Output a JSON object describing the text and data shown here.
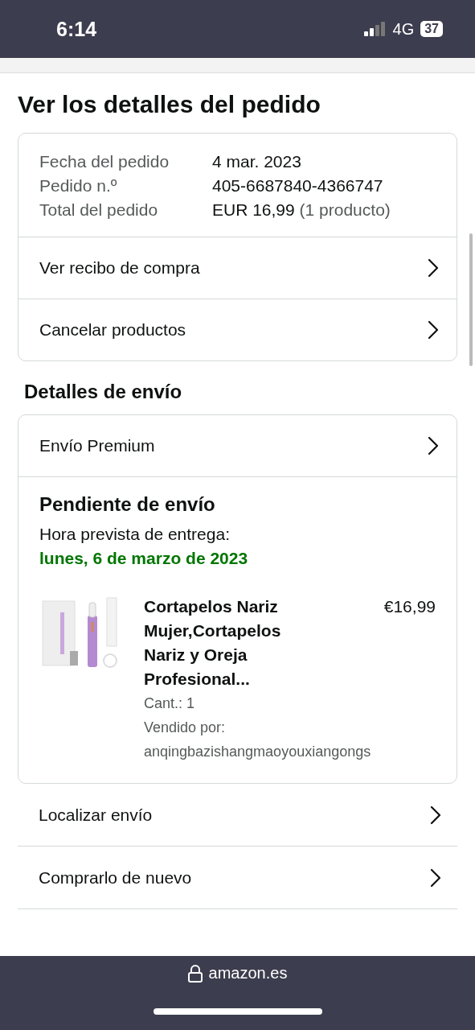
{
  "status_bar": {
    "time": "6:14",
    "network": "4G",
    "battery": "37"
  },
  "title": "Ver los detalles del pedido",
  "order_summary": {
    "rows": [
      {
        "label": "Fecha del pedido",
        "value": "4 mar. 2023"
      },
      {
        "label": "Pedido n.º",
        "value": "405-6687840-4366747"
      },
      {
        "label": "Total del pedido",
        "value": "EUR 16,99",
        "note": "(1 producto)"
      }
    ],
    "links": [
      "Ver recibo de compra",
      "Cancelar productos"
    ]
  },
  "shipping": {
    "heading": "Detalles de envío",
    "method": "Envío Premium",
    "status": "Pendiente de envío",
    "eta_label": "Hora prevista de entrega:",
    "eta_date": "lunes, 6 de marzo de 2023",
    "items": [
      {
        "title": "Cortapelos Nariz Mujer,Cortapelos Nariz y Oreja Profesional...",
        "price": "€16,99",
        "quantity": "Cant.: 1",
        "sold_by_label": "Vendido por:",
        "seller": "anqingbazishangmaoyouxiangongs"
      }
    ]
  },
  "actions": [
    "Localizar envío",
    "Comprarlo de nuevo"
  ],
  "browser_bar": {
    "domain": "amazon.es"
  }
}
